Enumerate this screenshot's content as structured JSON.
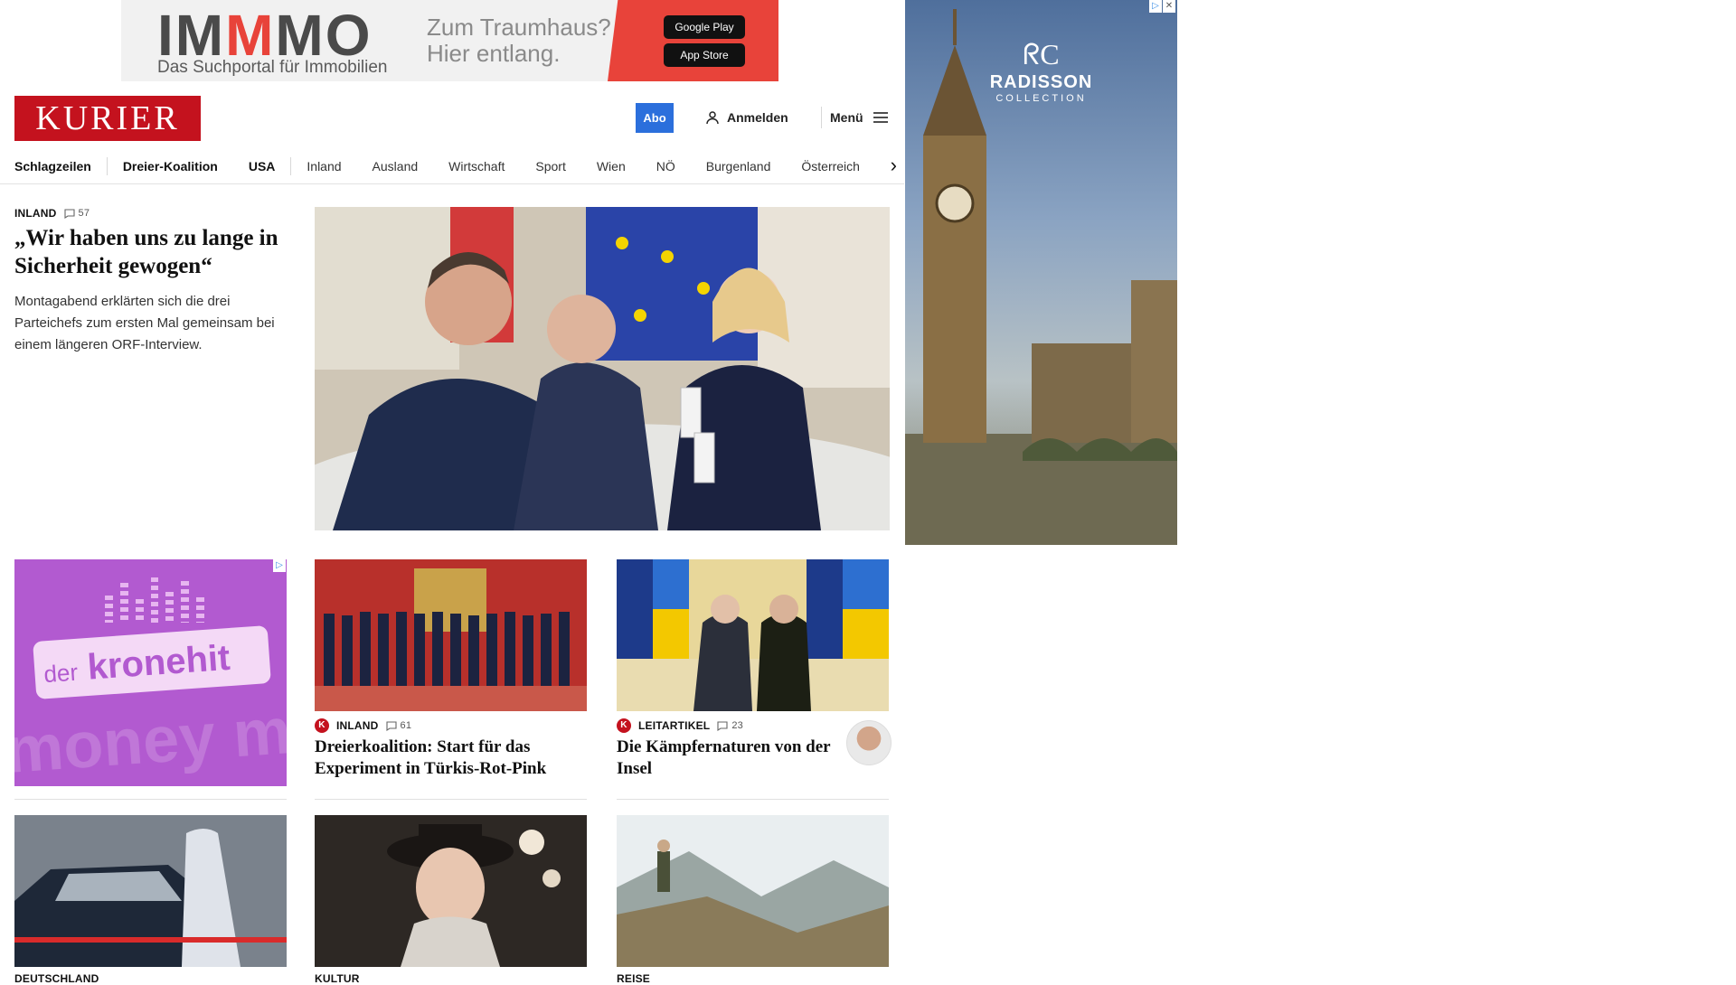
{
  "top_ad": {
    "brand_prefix": "IM",
    "brand_m": "M",
    "brand_suffix": "MO",
    "subtitle": "Das Suchportal für Immobilien",
    "tagline_1": "Zum Traumhaus?",
    "tagline_2": "Hier entlang.",
    "google_play": "Google Play",
    "app_store": "App Store"
  },
  "header": {
    "logo": "KURIER",
    "abo": "Abo",
    "login": "Anmelden",
    "menu": "Menü"
  },
  "nav": {
    "items": [
      "Schlagzeilen",
      "Dreier-Koalition",
      "USA",
      "Inland",
      "Ausland",
      "Wirtschaft",
      "Sport",
      "Wien",
      "NÖ",
      "Burgenland",
      "Österreich"
    ]
  },
  "lead": {
    "kicker": "INLAND",
    "comments": "57",
    "title": "„Wir haben uns zu lange in Sicherheit gewogen“",
    "teaser": "Montagabend erklärten sich die drei Parteichefs zum ersten Mal gemeinsam bei einem längeren ORF-Interview."
  },
  "side_ad": {
    "brand": "RADISSON",
    "sub": "COLLECTION"
  },
  "kronehit_ad": {
    "small": "der",
    "big": "kronehit",
    "bg": "money m"
  },
  "cards": [
    {
      "kicker": "INLAND",
      "comments": "61",
      "title": "Dreierkoalition: Start für das Experiment in Türkis-Rot-Pink"
    },
    {
      "kicker": "LEITARTIKEL",
      "comments": "23",
      "title": "Die Kämpfernaturen von der Insel"
    }
  ],
  "bottom_cards": [
    {
      "kicker": "DEUTSCHLAND"
    },
    {
      "kicker": "KULTUR"
    },
    {
      "kicker": "REISE"
    }
  ],
  "colors": {
    "brand_red": "#c4121e",
    "abo_blue": "#2b6fdc",
    "ad_red": "#e8433a",
    "kronehit_purple": "#b25ad0"
  }
}
